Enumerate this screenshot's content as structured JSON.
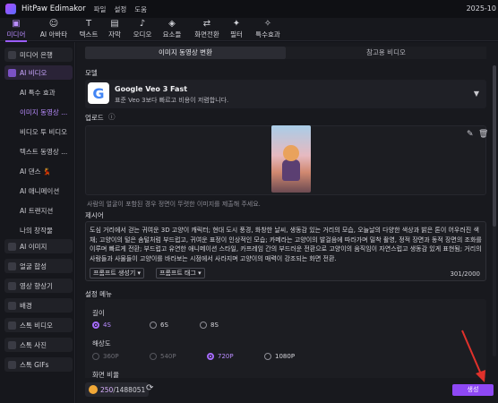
{
  "titlebar": {
    "app_name": "HitPaw Edimakor",
    "menu": [
      "파일",
      "설정",
      "도움"
    ],
    "year": "2025-10"
  },
  "toolbar": [
    {
      "label": "미디어",
      "icon": "media-icon",
      "glyph": "▣",
      "active": true
    },
    {
      "label": "AI 아바타",
      "icon": "avatar-icon",
      "glyph": "☺"
    },
    {
      "label": "텍스트",
      "icon": "text-icon",
      "glyph": "T"
    },
    {
      "label": "자막",
      "icon": "subtitle-icon",
      "glyph": "▤"
    },
    {
      "label": "오디오",
      "icon": "audio-icon",
      "glyph": "♪"
    },
    {
      "label": "요소들",
      "icon": "elements-icon",
      "glyph": "◈"
    },
    {
      "label": "화면전환",
      "icon": "transition-icon",
      "glyph": "⇄"
    },
    {
      "label": "필터",
      "icon": "filter-icon",
      "glyph": "✦"
    },
    {
      "label": "특수효과",
      "icon": "effects-icon",
      "glyph": "✧"
    }
  ],
  "sidebar": {
    "library": "미디어 은행",
    "ai_video": "AI 비디오",
    "ai_video_items": [
      "AI 특수 효과",
      "이미지 동영상 ...",
      "비디오 투 비디오",
      "텍스트 동영상 ...",
      "AI 댄스 💃",
      "AI 애니메이션",
      "AI 트랜지션",
      "나의 창작물"
    ],
    "groups": [
      "AI 이미지",
      "얼굴 합성",
      "영상 향상기",
      "배경",
      "스톡 비디오",
      "스톡 사진",
      "스톡 GIFs"
    ]
  },
  "main": {
    "tabs": [
      "이미지 동영상 변환",
      "참고용 비디오"
    ],
    "model_label": "모델",
    "model_name": "Google Veo 3 Fast",
    "model_desc": "표준 Veo 3보다 빠르고 비용이 저렴합니다.",
    "upload_label": "업로드",
    "upload_hint": "사람의 얼굴이 포함된 경우 정면이 뚜렷한 이미지를 제출해 주세요.",
    "prompt_label": "제시어",
    "prompt_text": "도심 거리에서 걷는 귀여운 3D 고양이 캐릭터; 현대 도시 풍경, 화창한 날씨, 생동감 있는 거리의 모습, 오늘날의 다양한 색상과 밝은 톤이 어우러진 색채; 고양이의 털은 솜털처럼 부드럽고, 귀여운 표정이 인상적인 모습; 카메라는 고양이의 발걸음에 따라가며 밀착 촬영, 정적 장면과 동적 장면의 조화를 이루며 빠르게 전환; 부드럽고 유연한 애니메이션 스타일, 카프레임 간의 부드러운 전환으로 고양이의 움직임이 자연스럽고 생동감 있게 표현됨; 거리의 사람들과 사물들이 고양이를 바라보는 시점에서 사라지며 고양이의 매력이 강조되는 화면 전환.",
    "prompt_generator_button": "프롬프트 생성기 ▾",
    "prompt_tag_button": "프롬프트 태그 ▾",
    "prompt_count": "301/2000",
    "settings_label": "설정 메뉴",
    "length_label": "길이",
    "lengths": [
      "4S",
      "6S",
      "8S"
    ],
    "length_selected": "4S",
    "resolution_label": "해상도",
    "resolutions": [
      "360P",
      "540P",
      "720P",
      "1080P"
    ],
    "resolution_selected": "720P",
    "aspect_label": "화면 비율"
  },
  "footer": {
    "coins_used": "250",
    "coins_total": "/1488051",
    "generate_button": "생성"
  },
  "colors": {
    "accent": "#9b5cff",
    "generate": "#8e48f5",
    "arrow": "#e0312b",
    "coin": "#f1a837"
  }
}
